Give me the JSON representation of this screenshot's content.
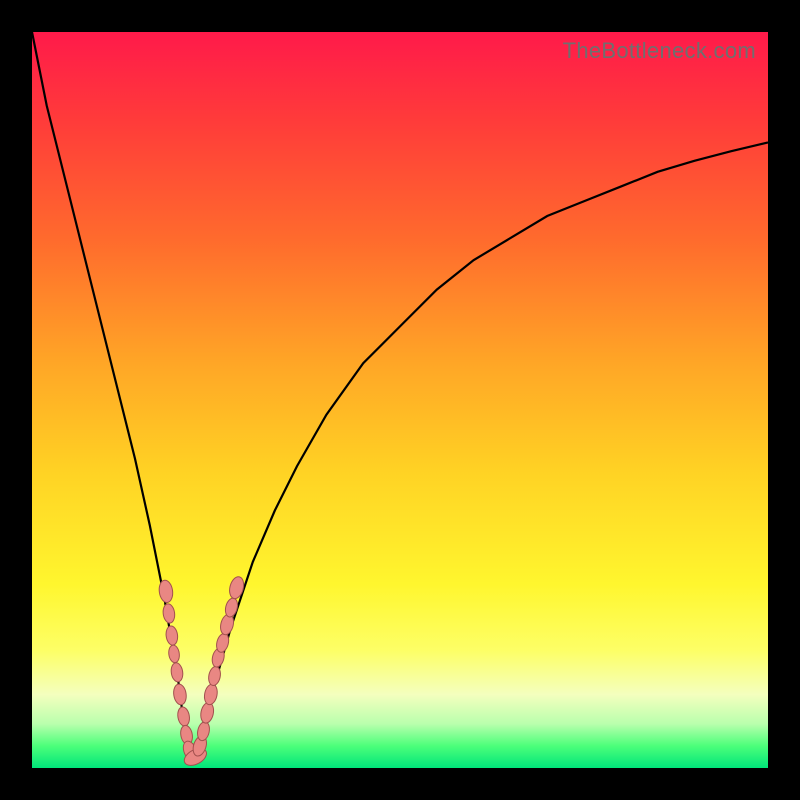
{
  "watermark": "TheBottleneck.com",
  "colors": {
    "curve": "#000000",
    "marker_fill": "#e98783",
    "marker_stroke": "#a2504e",
    "grad_top": "#ff1a4a",
    "grad_bottom": "#00e57a"
  },
  "chart_data": {
    "type": "line",
    "title": "",
    "xlabel": "",
    "ylabel": "",
    "xlim": [
      0,
      100
    ],
    "ylim": [
      0,
      100
    ],
    "series": [
      {
        "name": "curve",
        "x": [
          0,
          2,
          5,
          8,
          10,
          12,
          14,
          16,
          18,
          19,
          20,
          20.5,
          21,
          21.5,
          22,
          22.5,
          23,
          24,
          25,
          27,
          30,
          33,
          36,
          40,
          45,
          50,
          55,
          60,
          65,
          70,
          75,
          80,
          85,
          90,
          95,
          100
        ],
        "y": [
          100,
          90,
          78,
          66,
          58,
          50,
          42,
          33,
          23,
          17,
          11,
          7,
          4,
          2,
          1,
          2,
          4,
          8,
          12,
          19,
          28,
          35,
          41,
          48,
          55,
          60,
          65,
          69,
          72,
          75,
          77,
          79,
          81,
          82.5,
          83.8,
          85
        ]
      }
    ],
    "markers": {
      "name": "clusters",
      "x": [
        18.2,
        18.6,
        19.0,
        19.3,
        19.7,
        20.1,
        20.6,
        21.0,
        21.5,
        22.2,
        22.8,
        23.3,
        23.8,
        24.3,
        24.8,
        25.3,
        25.9,
        26.5,
        27.1,
        27.8
      ],
      "y": [
        24,
        21,
        18,
        15.5,
        13,
        10,
        7,
        4.5,
        2.3,
        1.5,
        3,
        5,
        7.5,
        10,
        12.5,
        15,
        17,
        19.5,
        21.8,
        24.5
      ],
      "r": [
        7,
        6,
        6,
        5.5,
        6,
        6.5,
        6,
        6,
        6.5,
        7.5,
        6.5,
        6,
        6.5,
        6.5,
        6,
        6,
        6,
        6.5,
        6,
        7
      ]
    }
  }
}
